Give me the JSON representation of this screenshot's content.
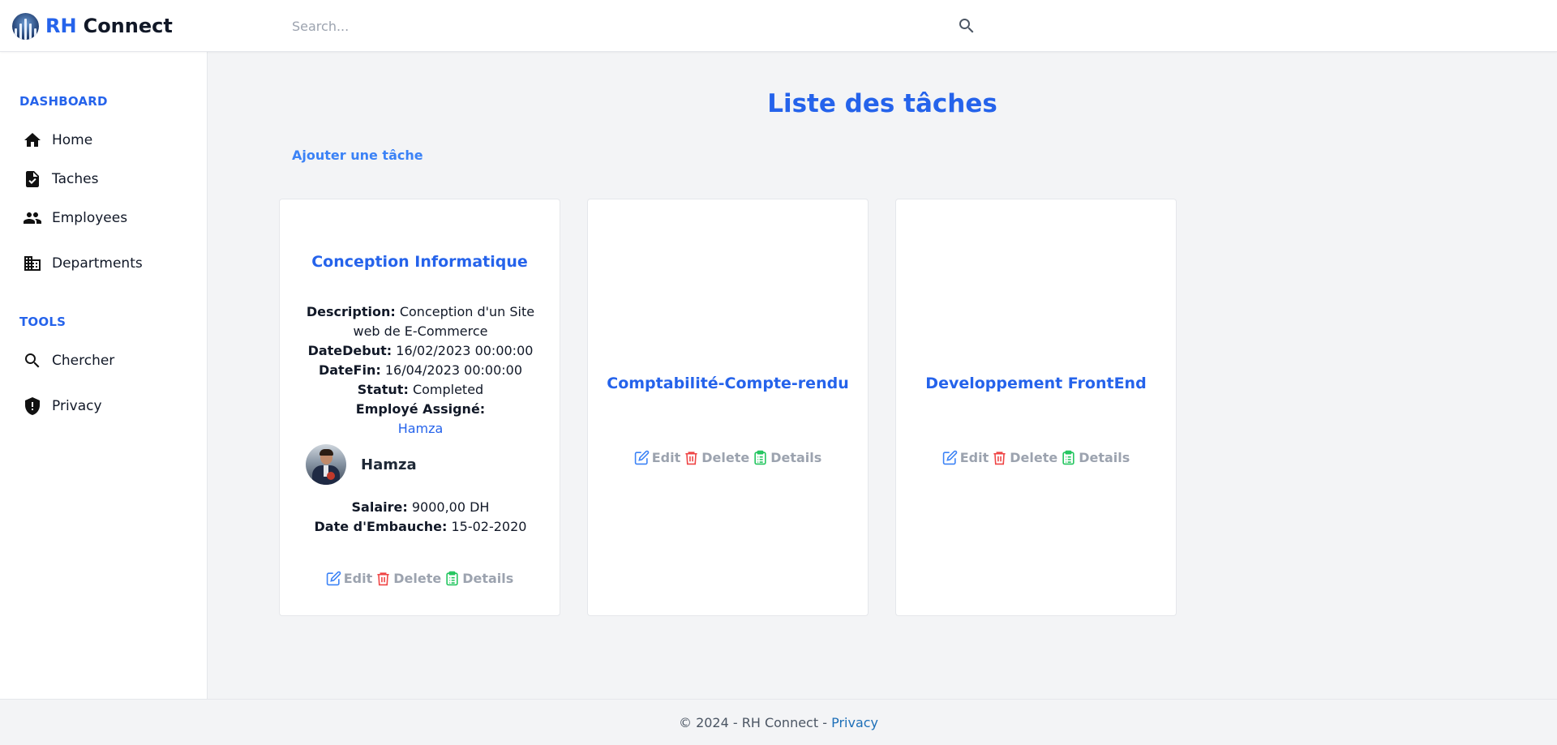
{
  "header": {
    "brand_rh": "RH",
    "brand_connect": "Connect",
    "search_placeholder": "Search..."
  },
  "sidebar": {
    "sections": [
      {
        "label": "DASHBOARD"
      },
      {
        "label": "TOOLS"
      }
    ],
    "items": [
      {
        "label": "Home",
        "icon": "home-icon"
      },
      {
        "label": "Taches",
        "icon": "task-document-icon"
      },
      {
        "label": "Employees",
        "icon": "people-icon"
      },
      {
        "label": "Departments",
        "icon": "building-icon"
      },
      {
        "label": "Chercher",
        "icon": "search-icon"
      },
      {
        "label": "Privacy",
        "icon": "shield-icon"
      }
    ]
  },
  "main": {
    "title": "Liste des tâches",
    "add_link": "Ajouter une tâche",
    "tasks": [
      {
        "title": "Conception Informatique",
        "description_label": "Description:",
        "description": "Conception d'un Site web de E-Commerce",
        "date_debut_label": "DateDebut:",
        "date_debut": "16/02/2023 00:00:00",
        "date_fin_label": "DateFin:",
        "date_fin": "16/04/2023 00:00:00",
        "statut_label": "Statut:",
        "statut": "Completed",
        "employe_label": "Employé Assigné:",
        "employe_link": "Hamza",
        "employe_name": "Hamza",
        "salaire_label": "Salaire:",
        "salaire": "9000,00 DH",
        "embauche_label": "Date d'Embauche:",
        "embauche": "15-02-2020"
      },
      {
        "title": "Comptabilité-Compte-rendu"
      },
      {
        "title": "Developpement FrontEnd"
      }
    ],
    "actions": {
      "edit": "Edit",
      "delete": "Delete",
      "details": "Details"
    }
  },
  "footer": {
    "text": "© 2024 - RH Connect - ",
    "privacy": "Privacy"
  },
  "colors": {
    "accent": "#2563eb",
    "edit": "#3b82f6",
    "delete": "#ef4444",
    "details": "#22c55e"
  }
}
